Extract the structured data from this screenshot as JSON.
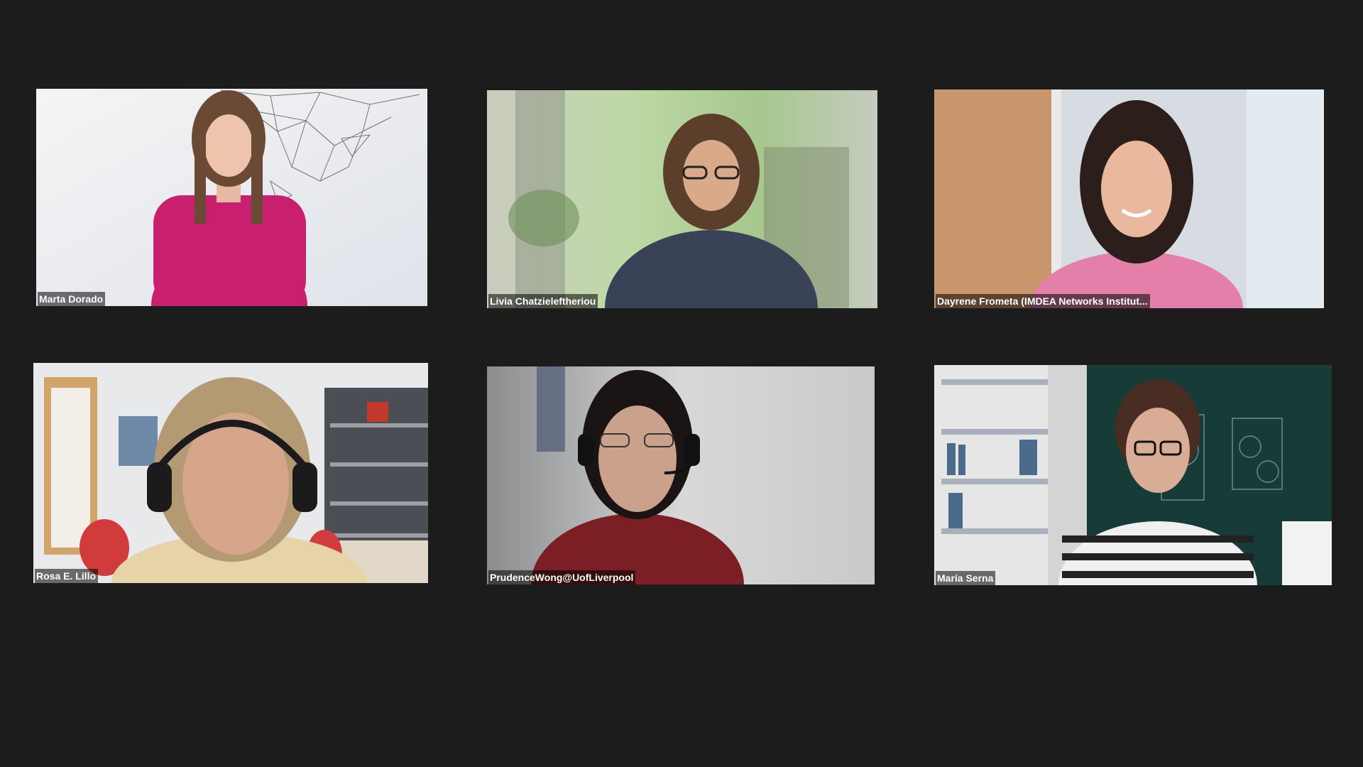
{
  "meeting": {
    "participants": [
      {
        "name": "Marta Dorado"
      },
      {
        "name": "Livia Chatzieleftheriou"
      },
      {
        "name": "Dayrene Frometa (IMDEA Networks Institut..."
      },
      {
        "name": "Rosa E. Lillo"
      },
      {
        "name": "PrudenceWong@UofLiverpool"
      },
      {
        "name": "María Serna"
      }
    ]
  }
}
